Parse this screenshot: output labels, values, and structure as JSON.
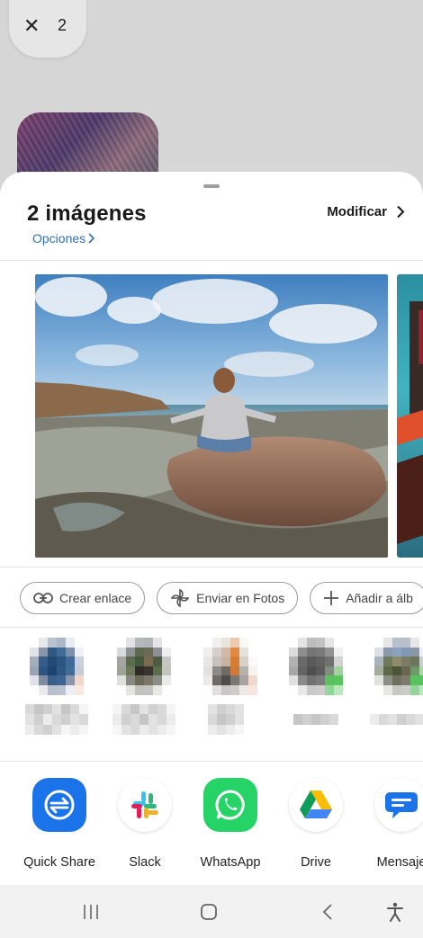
{
  "background": {
    "close_glyph": "✕",
    "count": "2"
  },
  "sheet": {
    "title": "2 imágenes",
    "options_label": "Opciones",
    "modify_label": "Modificar"
  },
  "actions": [
    {
      "label": "Crear enlace",
      "icon": "link-icon"
    },
    {
      "label": "Enviar en Fotos",
      "icon": "pinwheel-icon"
    },
    {
      "label": "Añadir a álb",
      "icon": "plus-icon"
    }
  ],
  "apps": [
    {
      "label": "Quick Share",
      "icon": "quick-share-icon",
      "color": "#1a73e8"
    },
    {
      "label": "Slack",
      "icon": "slack-icon",
      "color": "#ffffff"
    },
    {
      "label": "WhatsApp",
      "icon": "whatsapp-icon",
      "color": "#25d366"
    },
    {
      "label": "Drive",
      "icon": "drive-icon",
      "color": "#ffffff"
    },
    {
      "label": "Mensaje",
      "icon": "messages-icon",
      "color": "#1a73e8"
    }
  ],
  "colors": {
    "accent_link": "#2f6fb3"
  }
}
